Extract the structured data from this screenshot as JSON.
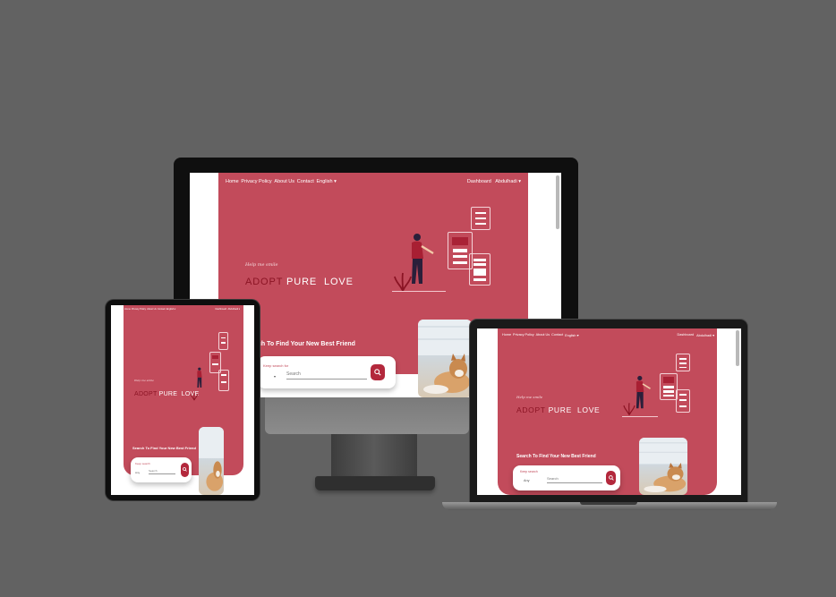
{
  "site": {
    "nav": {
      "items": [
        "Home",
        "Privacy Policy",
        "About Us",
        "Contact",
        "English ▾"
      ],
      "dashboard": "Dashboard",
      "user": "Abdulhadi ▾"
    },
    "hero": {
      "tagline": "Help me smile",
      "headline_adopt": "ADOPT",
      "headline_rest": "PURE  LOVE"
    },
    "search": {
      "title": "Search To Find Your New Best Friend",
      "label": "Keep search",
      "select": "Any",
      "placeholder": "Search",
      "button_icon": "magnifier-icon"
    }
  },
  "desktop_crop": {
    "title": "ch To Find Your New Best Friend",
    "label": "Keep search for",
    "select": "▾"
  },
  "tablet_crop": {
    "label": "Keep search",
    "select": "Any",
    "placeholder": "Search"
  },
  "colors": {
    "background": "#626262",
    "hero": "#c24b5b",
    "accent_dark": "#8b1424",
    "button": "#b3283c",
    "device_body": "#111111"
  }
}
